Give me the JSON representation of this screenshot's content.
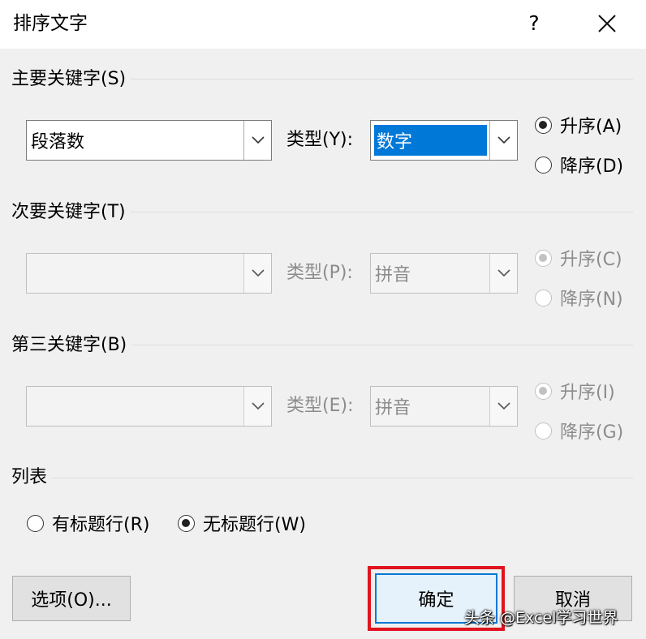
{
  "window": {
    "title": "排序文字",
    "help_glyph": "?"
  },
  "primary": {
    "group_title": "主要关键字(S)",
    "key_value": "段落数",
    "type_label": "类型(Y):",
    "type_value": "数字",
    "asc_label": "升序(A)",
    "desc_label": "降序(D)",
    "order": "asc"
  },
  "secondary": {
    "group_title": "次要关键字(T)",
    "key_value": "",
    "type_label": "类型(P):",
    "type_value": "拼音",
    "asc_label": "升序(C)",
    "desc_label": "降序(N)",
    "disabled": true
  },
  "tertiary": {
    "group_title": "第三关键字(B)",
    "key_value": "",
    "type_label": "类型(E):",
    "type_value": "拼音",
    "asc_label": "升序(I)",
    "desc_label": "降序(G)",
    "disabled": true
  },
  "list": {
    "group_title": "列表",
    "header_row_label": "有标题行(R)",
    "no_header_row_label": "无标题行(W)",
    "selected": "no_header_row"
  },
  "buttons": {
    "options_label": "选项(O)...",
    "ok_label": "确定",
    "cancel_label": "取消"
  },
  "watermark": "头条 @Excel学习世界",
  "colors": {
    "selection": "#0078d7",
    "highlight_box": "#e0141e",
    "default_button_border": "#0078d7"
  },
  "icons": {
    "close": "close-icon",
    "help": "help-icon",
    "dropdown": "chevron-down-icon"
  }
}
